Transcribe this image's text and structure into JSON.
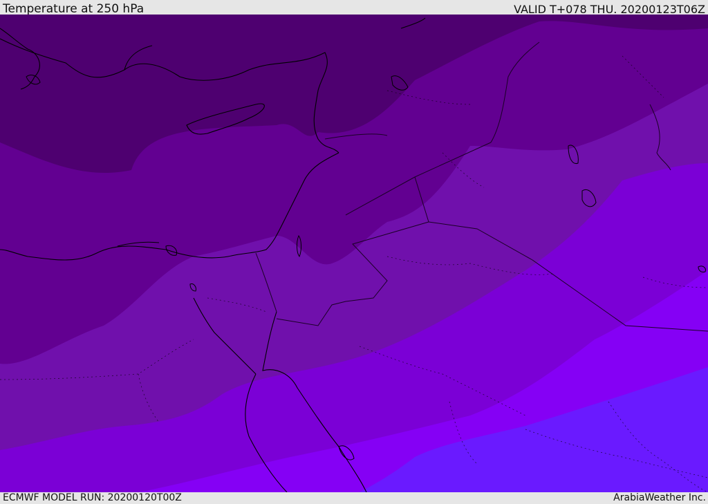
{
  "header": {
    "title": "Temperature at 250 hPa",
    "valid": "VALID T+078 THU. 20200123T06Z"
  },
  "footer": {
    "model_run": "ECMWF MODEL RUN: 20200120T00Z",
    "credit": "ArabiaWeather Inc."
  },
  "map": {
    "variable": "temperature",
    "level": "250 hPa",
    "colors": {
      "band1": "#4e0070",
      "band2": "#620091",
      "band3": "#7010ac",
      "band4": "#7b00d6",
      "band5": "#8500f5",
      "band6": "#6a1aff",
      "coast": "#000000",
      "border": "#1a0025"
    }
  }
}
